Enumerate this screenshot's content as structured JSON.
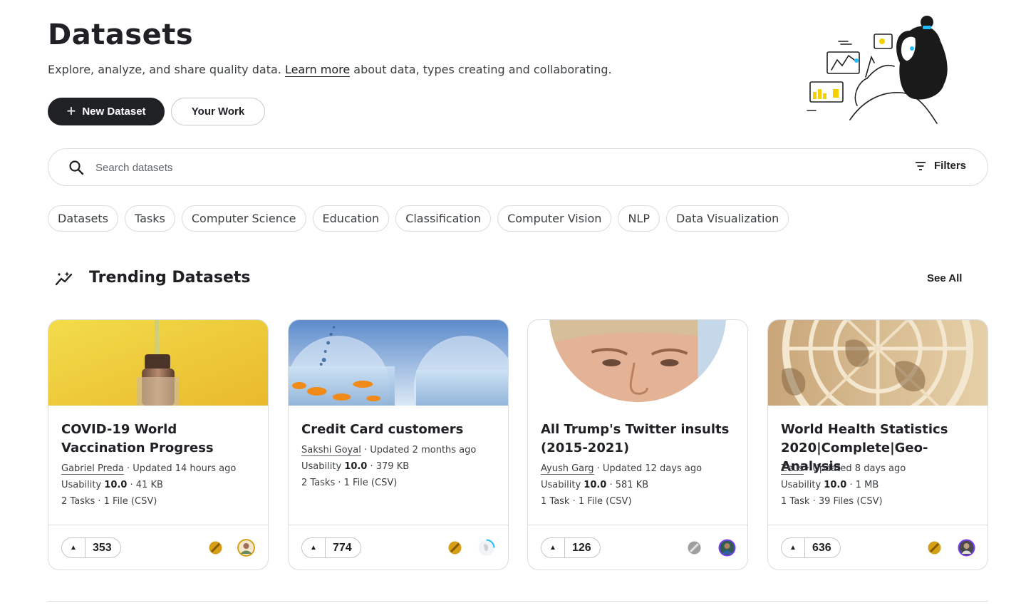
{
  "header": {
    "title": "Datasets",
    "intro_before": "Explore, analyze, and share quality data.",
    "intro_link": "Learn more",
    "intro_after": "about data, types creating and collaborating.",
    "new_dataset_label": "New Dataset",
    "your_work_label": "Your Work"
  },
  "search": {
    "placeholder": "Search datasets",
    "value": "",
    "filters_label": "Filters"
  },
  "chips": [
    "Datasets",
    "Tasks",
    "Computer Science",
    "Education",
    "Classification",
    "Computer Vision",
    "NLP",
    "Data Visualization"
  ],
  "trending": {
    "title": "Trending Datasets",
    "see_all": "See All",
    "cards": [
      {
        "title": "COVID-19 World Vaccination Progress",
        "author": "Gabriel Preda",
        "updated": "· Updated 14 hours ago",
        "usability_label": "Usability",
        "usability": "10.0",
        "size": "· 41 KB",
        "files": "2 Tasks · 1 File (CSV)",
        "votes": "353",
        "medal": "gold",
        "image": "vaccine-vial"
      },
      {
        "title": "Credit Card customers",
        "author": "Sakshi Goyal",
        "updated": "· Updated 2 months ago",
        "usability_label": "Usability",
        "usability": "10.0",
        "size": "· 379 KB",
        "files": "2 Tasks · 1 File (CSV)",
        "votes": "774",
        "medal": "gold",
        "image": "fishbowls"
      },
      {
        "title": "All Trump's Twitter insults (2015-2021)",
        "author": "Ayush Garg",
        "updated": "· Updated 12 days ago",
        "usability_label": "Usability",
        "usability": "10.0",
        "size": "· 581 KB",
        "files": "1 Task · 1 File (CSV)",
        "votes": "126",
        "medal": "silver",
        "image": "portrait"
      },
      {
        "title": "World Health Statistics 2020|Complete|Geo-Analysis",
        "author": "Zeus",
        "updated": "· Updated 8 days ago",
        "usability_label": "Usability",
        "usability": "10.0",
        "size": "· 1 MB",
        "files": "1 Task · 39 Files (CSV)",
        "votes": "636",
        "medal": "gold",
        "image": "un-emblem"
      }
    ]
  },
  "colors": {
    "primary_button": "#202124",
    "gold_medal": "#d4a017",
    "silver_medal": "#9e9e9e",
    "accent_blue": "#20beff",
    "accent_purple": "#7b3ff2"
  }
}
